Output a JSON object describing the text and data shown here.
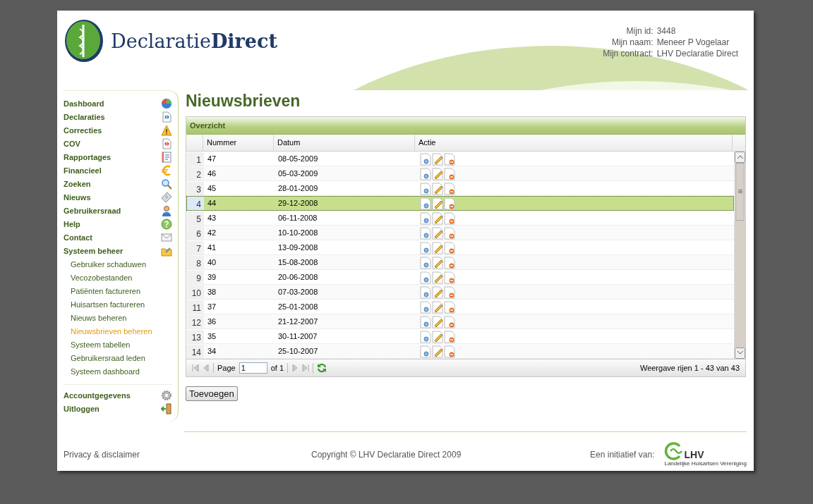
{
  "header": {
    "logo": {
      "light": "Declaratie",
      "bold": "Direct"
    },
    "user_info": [
      {
        "label": "Mijn id:",
        "value": "3448"
      },
      {
        "label": "Mijn naam:",
        "value": "Meneer P Vogelaar"
      },
      {
        "label": "Mijn contract:",
        "value": "LHV Declaratie Direct"
      }
    ]
  },
  "sidebar": {
    "groups": [
      {
        "items": [
          {
            "label": "Dashboard",
            "kind": "main",
            "selected": false
          },
          {
            "label": "Declaraties",
            "kind": "main",
            "selected": false
          },
          {
            "label": "Correcties",
            "kind": "main",
            "selected": false
          },
          {
            "label": "COV",
            "kind": "main",
            "selected": false
          },
          {
            "label": "Rapportages",
            "kind": "main",
            "selected": false
          },
          {
            "label": "Financieel",
            "kind": "main",
            "selected": false
          },
          {
            "label": "Zoeken",
            "kind": "main",
            "selected": false
          },
          {
            "label": "Nieuws",
            "kind": "main",
            "selected": false
          },
          {
            "label": "Gebruikersraad",
            "kind": "main",
            "selected": false
          },
          {
            "label": "Help",
            "kind": "main",
            "selected": false
          },
          {
            "label": "Contact",
            "kind": "main",
            "selected": false
          },
          {
            "label": "Systeem beheer",
            "kind": "main",
            "selected": false
          },
          {
            "label": "Gebruiker schaduwen",
            "kind": "sub",
            "selected": false
          },
          {
            "label": "Vecozobestanden",
            "kind": "sub",
            "selected": false
          },
          {
            "label": "Patiënten factureren",
            "kind": "sub",
            "selected": false
          },
          {
            "label": "Huisartsen factureren",
            "kind": "sub",
            "selected": false
          },
          {
            "label": "Nieuws beheren",
            "kind": "sub",
            "selected": false
          },
          {
            "label": "Nieuwsbrieven beheren",
            "kind": "sub",
            "selected": true
          },
          {
            "label": "Systeem tabellen",
            "kind": "sub",
            "selected": false
          },
          {
            "label": "Gebruikersraad leden",
            "kind": "sub",
            "selected": false
          },
          {
            "label": "Systeem dashboard",
            "kind": "sub",
            "selected": false
          }
        ]
      },
      {
        "items": [
          {
            "label": "Accountgegevens",
            "kind": "main",
            "selected": false
          },
          {
            "label": "Uitloggen",
            "kind": "main",
            "selected": false
          }
        ]
      }
    ]
  },
  "page_title": "Nieuwsbrieven",
  "grid": {
    "title": "Overzicht",
    "columns": [
      "Nummer",
      "Datum",
      "Actie"
    ],
    "rows": [
      {
        "index": "1",
        "nummer": "47",
        "datum": "08-05-2009",
        "selected": false
      },
      {
        "index": "2",
        "nummer": "46",
        "datum": "05-03-2009",
        "selected": false
      },
      {
        "index": "3",
        "nummer": "45",
        "datum": "28-01-2009",
        "selected": false
      },
      {
        "index": "4",
        "nummer": "44",
        "datum": "29-12-2008",
        "selected": true
      },
      {
        "index": "5",
        "nummer": "43",
        "datum": "06-11-2008",
        "selected": false
      },
      {
        "index": "6",
        "nummer": "42",
        "datum": "10-10-2008",
        "selected": false
      },
      {
        "index": "7",
        "nummer": "41",
        "datum": "13-09-2008",
        "selected": false
      },
      {
        "index": "8",
        "nummer": "40",
        "datum": "15-08-2008",
        "selected": false
      },
      {
        "index": "9",
        "nummer": "39",
        "datum": "20-06-2008",
        "selected": false
      },
      {
        "index": "10",
        "nummer": "38",
        "datum": "07-03-2008",
        "selected": false
      },
      {
        "index": "11",
        "nummer": "37",
        "datum": "25-01-2008",
        "selected": false
      },
      {
        "index": "12",
        "nummer": "36",
        "datum": "21-12-2007",
        "selected": false
      },
      {
        "index": "13",
        "nummer": "35",
        "datum": "30-11-2007",
        "selected": false
      },
      {
        "index": "14",
        "nummer": "34",
        "datum": "25-10-2007",
        "selected": false
      }
    ],
    "pager": {
      "page_label": "Page",
      "page_value": "1",
      "of_label": "of 1",
      "summary": "Weergave rijen 1 - 43 van 43"
    }
  },
  "add_button": "Toevoegen",
  "footer": {
    "privacy_link": "Privacy & disclaimer",
    "copyright": "Copyright © LHV Declaratie Direct 2009",
    "initiative_label": "Een initiatief van:",
    "partner_logo": {
      "name": "LHV",
      "subtitle": "Landelijke Huisartsen Vereniging"
    }
  }
}
